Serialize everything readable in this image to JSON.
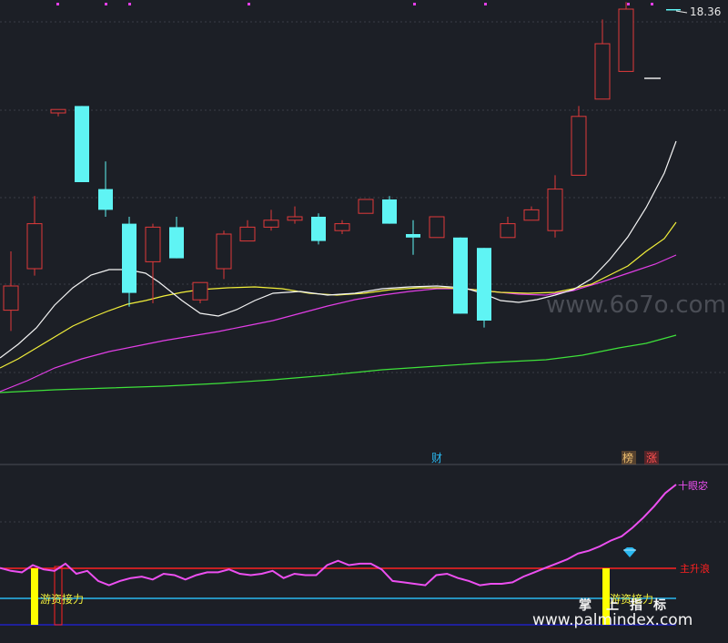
{
  "colors": {
    "background": "#1c1f26",
    "grid": "#3a3d46",
    "up": "#e03a3a",
    "down": "#5ff4f4",
    "ma5": "#f4f4f4",
    "ma10": "#f2ef3a",
    "ma20": "#e23ee6",
    "ma60": "#3ee23a",
    "osc_line": "#ec4ff0",
    "red_level": "#ff2020",
    "blue_level": "#2ab8f0",
    "dark_level": "#2020c0",
    "signal_bar": "#ffff00"
  },
  "chart_data": [
    {
      "type": "candlestick",
      "price_label": "18.36",
      "annotations": {
        "fin_marker": "财",
        "bang_marker": "榜",
        "zhang_marker": "涨"
      },
      "candles": [
        {
          "o": 0.87,
          "c": 0.8,
          "h": 0.93,
          "l": 0.7
        },
        {
          "o": 0.75,
          "c": 0.62,
          "h": 0.77,
          "l": 0.54
        },
        {
          "o": 0.3,
          "c": 0.29,
          "h": 0.31,
          "l": 0.3
        },
        {
          "o": 0.28,
          "c": 0.5,
          "h": 0.28,
          "l": 0.5
        },
        {
          "o": 0.52,
          "c": 0.58,
          "h": 0.44,
          "l": 0.6
        },
        {
          "o": 0.62,
          "c": 0.82,
          "h": 0.6,
          "l": 0.86
        },
        {
          "o": 0.73,
          "c": 0.63,
          "h": 0.62,
          "l": 0.85
        },
        {
          "o": 0.63,
          "c": 0.72,
          "h": 0.6,
          "l": 0.72
        },
        {
          "o": 0.84,
          "c": 0.79,
          "h": 0.79,
          "l": 0.85
        },
        {
          "o": 0.75,
          "c": 0.65,
          "h": 0.64,
          "l": 0.78
        },
        {
          "o": 0.67,
          "c": 0.63,
          "h": 0.61,
          "l": 0.67
        },
        {
          "o": 0.63,
          "c": 0.61,
          "h": 0.58,
          "l": 0.64
        },
        {
          "o": 0.61,
          "c": 0.6,
          "h": 0.57,
          "l": 0.62
        },
        {
          "o": 0.6,
          "c": 0.67,
          "h": 0.59,
          "l": 0.68
        },
        {
          "o": 0.64,
          "c": 0.62,
          "h": 0.61,
          "l": 0.65
        },
        {
          "o": 0.59,
          "c": 0.55,
          "h": 0.55,
          "l": 0.59
        },
        {
          "o": 0.55,
          "c": 0.62,
          "h": 0.54,
          "l": 0.62
        },
        {
          "o": 0.65,
          "c": 0.66,
          "h": 0.61,
          "l": 0.71
        },
        {
          "o": 0.66,
          "c": 0.6,
          "h": 0.6,
          "l": 0.6
        },
        {
          "o": 0.66,
          "c": 0.88,
          "h": 0.66,
          "l": 0.88
        },
        {
          "o": 0.69,
          "c": 0.9,
          "h": 0.69,
          "l": 0.92
        },
        {
          "o": 0.66,
          "c": 0.62,
          "h": 0.6,
          "l": 0.66
        },
        {
          "o": 0.61,
          "c": 0.58,
          "h": 0.57,
          "l": 0.61
        },
        {
          "o": 0.64,
          "c": 0.52,
          "h": 0.48,
          "l": 0.66
        },
        {
          "o": 0.48,
          "c": 0.31,
          "h": 0.28,
          "l": 0.48
        },
        {
          "o": 0.26,
          "c": 0.1,
          "h": 0.03,
          "l": 0.26
        },
        {
          "o": 0.18,
          "c": 0.0,
          "h": -0.02,
          "l": 0.18
        },
        {
          "o": -0.03,
          "c": -0.09,
          "h": -0.1,
          "l": -0.03
        },
        {
          "o": 0.0,
          "c": 0.0,
          "h": 0.0,
          "l": 0.0
        }
      ]
    },
    {
      "type": "line",
      "labels": {
        "main_wave": "主升浪",
        "top_level": "十眼宓",
        "hot_money_left": "游资接力",
        "hot_money_right": "游资接力",
        "watermark_chars": [
          "掌",
          "上",
          "指",
          "标"
        ]
      },
      "values": [
        0.42,
        0.4,
        0.39,
        0.44,
        0.41,
        0.4,
        0.45,
        0.38,
        0.4,
        0.33,
        0.3,
        0.33,
        0.35,
        0.36,
        0.34,
        0.38,
        0.37,
        0.34,
        0.37,
        0.39,
        0.39,
        0.41,
        0.38,
        0.37,
        0.38,
        0.4,
        0.35,
        0.38,
        0.37,
        0.37,
        0.44,
        0.47,
        0.44,
        0.45,
        0.45,
        0.41,
        0.33,
        0.32,
        0.31,
        0.3,
        0.37,
        0.38,
        0.35,
        0.33,
        0.3,
        0.31,
        0.31,
        0.32,
        0.36,
        0.39,
        0.42,
        0.45,
        0.48,
        0.52,
        0.54,
        0.57,
        0.61,
        0.64,
        0.7,
        0.77,
        0.85,
        0.94,
        1.0
      ]
    }
  ],
  "watermarks": {
    "top": "www.6o7o.com",
    "bottom": "www.palmindex.com"
  }
}
